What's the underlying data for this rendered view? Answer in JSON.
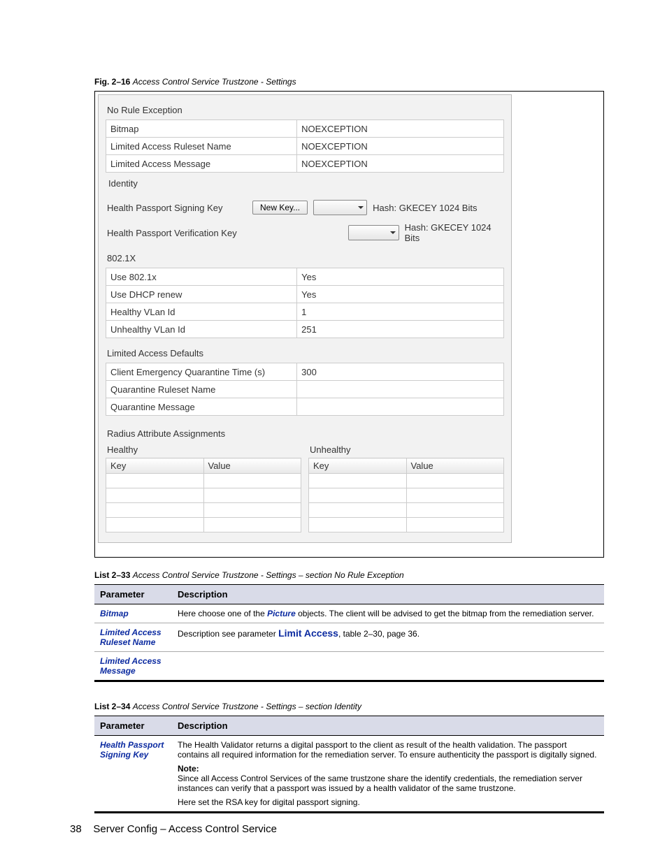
{
  "fig": {
    "label": "Fig. 2–16",
    "title": "Access Control Service Trustzone - Settings"
  },
  "panel": {
    "noRuleException": {
      "title": "No Rule Exception",
      "rows": [
        {
          "label": "Bitmap",
          "value": "NOEXCEPTION"
        },
        {
          "label": "Limited Access Ruleset Name",
          "value": "NOEXCEPTION"
        },
        {
          "label": "Limited Access Message",
          "value": "NOEXCEPTION"
        }
      ]
    },
    "identity": {
      "title": "Identity",
      "signing": {
        "label": "Health Passport Signing Key",
        "button": "New Key...",
        "hash": "Hash: GKECEY 1024 Bits"
      },
      "verification": {
        "label": "Health Passport Verification Key",
        "hash": "Hash: GKECEY 1024 Bits"
      }
    },
    "x8021": {
      "title": "802.1X",
      "rows": [
        {
          "label": "Use 802.1x",
          "value": "Yes"
        },
        {
          "label": "Use DHCP renew",
          "value": "Yes"
        },
        {
          "label": "Healthy VLan Id",
          "value": "1"
        },
        {
          "label": "Unhealthy VLan Id",
          "value": "251"
        }
      ]
    },
    "limitedDefaults": {
      "title": "Limited Access Defaults",
      "rows": [
        {
          "label": "Client Emergency Quarantine Time (s)",
          "value": "300"
        },
        {
          "label": "Quarantine Ruleset Name",
          "value": ""
        },
        {
          "label": "Quarantine Message",
          "value": ""
        }
      ]
    },
    "radius": {
      "title": "Radius Attribute Assignments",
      "healthy": {
        "title": "Healthy",
        "key": "Key",
        "value": "Value"
      },
      "unhealthy": {
        "title": "Unhealthy",
        "key": "Key",
        "value": "Value"
      }
    }
  },
  "list33": {
    "label": "List 2–33",
    "title": "Access Control Service Trustzone - Settings – section No Rule Exception",
    "hParam": "Parameter",
    "hDesc": "Description",
    "rows": {
      "bitmap": {
        "param": "Bitmap",
        "t1": "Here choose one of the ",
        "link": "Picture",
        "t2": " objects. The client will be advised to get the bitmap from the remediation server."
      },
      "laruleset": {
        "param": "Limited Access Ruleset Name",
        "t1": "Description see parameter ",
        "term": "Limit Access",
        "t2": ", table 2–30, page 36."
      },
      "lamsg": {
        "param": "Limited Access Message"
      }
    }
  },
  "list34": {
    "label": "List 2–34",
    "title": "Access Control Service Trustzone - Settings – section Identity",
    "hParam": "Parameter",
    "hDesc": "Description",
    "rows": {
      "signing": {
        "param": "Health Passport Signing Key",
        "p1": "The Health Validator returns a digital passport to the client as result of the health validation. The passport contains all required information for the remediation server. To ensure authenticity the passport is digitally signed.",
        "noteLabel": "Note:",
        "note": "Since all Access Control Services of the same trustzone share the identify credentials, the remediation server instances can verify that a passport was issued by a health validator of the same trustzone.",
        "p2": "Here set the RSA key for digital passport signing."
      }
    }
  },
  "footer": {
    "pageNum": "38",
    "text": "Server Config – Access Control Service"
  }
}
